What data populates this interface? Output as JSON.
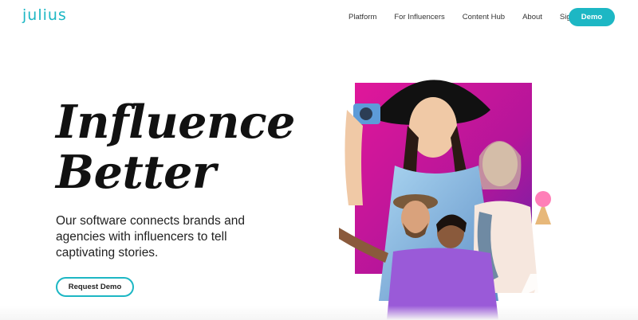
{
  "brand": {
    "logo_text": "julius",
    "accent_color": "#1db7c4"
  },
  "nav": {
    "links": [
      "Platform",
      "For Influencers",
      "Content Hub",
      "About",
      "Sign In"
    ],
    "demo_label": "Demo"
  },
  "hero": {
    "headline_line1": "Influence",
    "headline_line2": "Better",
    "subtext": "Our software connects brands and agencies with influencers to tell captivating stories.",
    "cta_label": "Request Demo",
    "art_colors": {
      "magenta": "#d0168f",
      "purple": "#7a2fb0",
      "sky": "#8cc4e8"
    }
  }
}
